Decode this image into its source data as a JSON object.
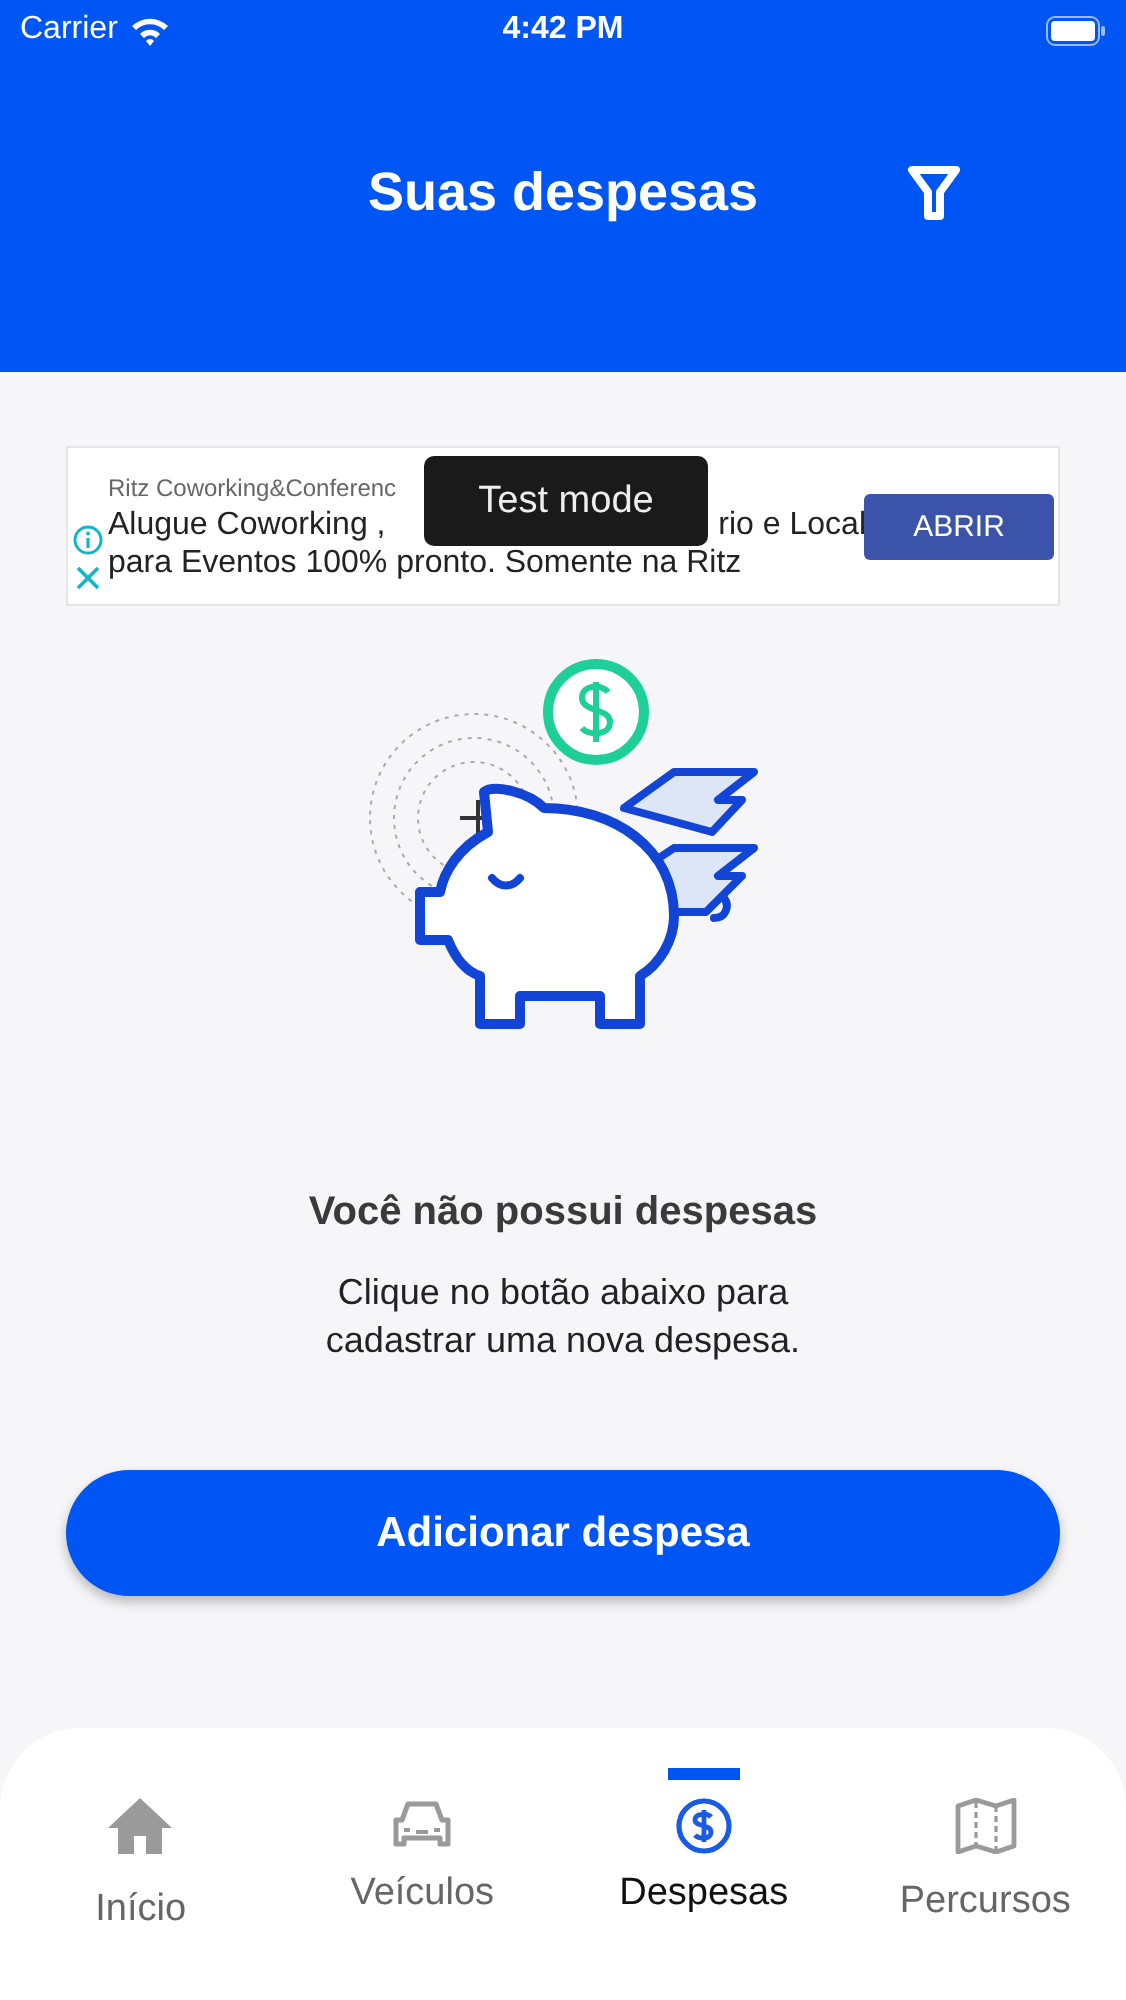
{
  "status_bar": {
    "carrier": "Carrier",
    "time": "4:42 PM"
  },
  "header": {
    "title": "Suas despesas"
  },
  "ad": {
    "advertiser": "Ritz Coworking&Conferenc",
    "headline_left": "Alugue Coworking ,",
    "headline_right": "rio e Local",
    "line_2": "para Eventos 100% pronto. Somente na Ritz",
    "cta": "ABRIR",
    "toast": "Test mode"
  },
  "empty_state": {
    "title": "Você não possui despesas",
    "message": "Clique no botão abaixo para cadastrar uma nova despesa."
  },
  "add_button": "Adicionar despesa",
  "tabs": [
    {
      "label": "Início",
      "selected": false
    },
    {
      "label": "Veículos",
      "selected": false
    },
    {
      "label": "Despesas",
      "selected": true
    },
    {
      "label": "Percursos",
      "selected": false
    }
  ]
}
